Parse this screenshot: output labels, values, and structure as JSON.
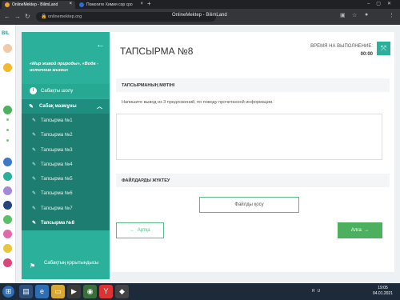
{
  "browser": {
    "tabs": [
      {
        "label": "OnlineMektep - BilimLand",
        "active": true,
        "favicon_color": "#e8a33a"
      },
      {
        "label": "Помогите Химия сор сро",
        "active": false,
        "favicon_color": "#2a6fd6"
      }
    ],
    "new_tab": "+",
    "url": "onlinemektep.org",
    "page_title": "OnlineMektep - BilimLand"
  },
  "app": {
    "brand": "BIL"
  },
  "sidebar": {
    "topic": "«Мир живой природы», «Вода - источник жизни»",
    "lesson_review": "Сабақты шолу",
    "lesson_content": "Сабақ мазмұны",
    "tasks": [
      "Тапсырма №1",
      "Тапсырма №2",
      "Тапсырма №3",
      "Тапсырма №4",
      "Тапсырма №5",
      "Тапсырма №6",
      "Тапсырма №7",
      "Тапсырма №8"
    ],
    "active_task_index": 7,
    "summary": "Сабақтың қорытындысы"
  },
  "main": {
    "title": "ТАПСЫРМА №8",
    "time_label": "ВРЕМЯ НА ВЫПОЛНЕНИЕ:",
    "time_value": "00:00",
    "text_section": "ТАПСЫРМАНЫҢ МӘТІНІ",
    "instruction": "Напишите вывод из 3 предложений, по поводу прочитанной информации.",
    "answer_value": "",
    "upload_section": "ФАЙЛДАРДЫ ЖҮКТЕУ",
    "upload_button": "Файлды қосу",
    "back_button": "Артқа",
    "next_button": "Алға"
  },
  "taskbar": {
    "tray": "RU",
    "time": "19:05",
    "date": "04.01.2021"
  },
  "colors": {
    "teal": "#2ab09b",
    "teal_dark": "#1d7d70",
    "green_button": "#4cb05e"
  }
}
